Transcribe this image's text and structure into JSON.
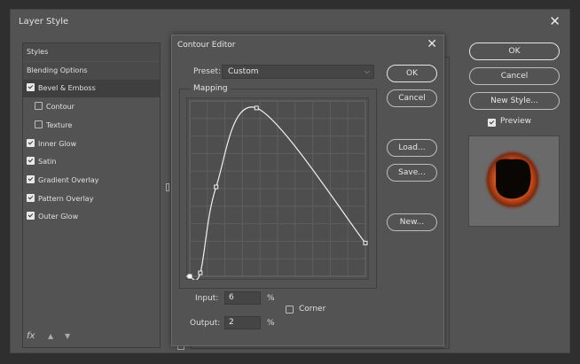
{
  "window": {
    "title": "Layer Style",
    "close_glyph": "✕"
  },
  "styles_list": [
    {
      "label": "Styles",
      "checkbox": false,
      "type": "header"
    },
    {
      "label": "Blending Options",
      "checkbox": false,
      "type": "header"
    },
    {
      "label": "Bevel & Emboss",
      "checkbox": true,
      "checked": true,
      "type": "selected"
    },
    {
      "label": "Contour",
      "checkbox": true,
      "checked": false,
      "type": "sub"
    },
    {
      "label": "Texture",
      "checkbox": true,
      "checked": false,
      "type": "sub"
    },
    {
      "label": "Inner Glow",
      "checkbox": true,
      "checked": true,
      "type": "item"
    },
    {
      "label": "Satin",
      "checkbox": true,
      "checked": true,
      "type": "item"
    },
    {
      "label": "Gradient Overlay",
      "checkbox": true,
      "checked": true,
      "type": "item"
    },
    {
      "label": "Pattern Overlay",
      "checkbox": true,
      "checked": true,
      "type": "item"
    },
    {
      "label": "Outer Glow",
      "checkbox": true,
      "checked": true,
      "type": "item"
    }
  ],
  "footer": {
    "fx_label": "fx",
    "up_glyph": "▲",
    "down_glyph": "▼"
  },
  "right_buttons": {
    "ok": "OK",
    "cancel": "Cancel",
    "new_style": "New Style..."
  },
  "preview": {
    "label": "Preview",
    "checked": true
  },
  "contour_editor": {
    "title": "Contour Editor",
    "close_glyph": "✕",
    "preset_label": "Preset:",
    "preset_value": "Custom",
    "mapping_label": "Mapping",
    "input_label": "Input:",
    "input_value": "6",
    "output_label": "Output:",
    "output_value": "2",
    "percent": "%",
    "corner_label": "Corner",
    "corner_checked": false,
    "buttons": {
      "ok": "OK",
      "cancel": "Cancel",
      "load": "Load...",
      "save": "Save...",
      "new": "New..."
    },
    "curve_points": [
      {
        "input": 0,
        "output": 0
      },
      {
        "input": 6,
        "output": 2
      },
      {
        "input": 15,
        "output": 51
      },
      {
        "input": 38,
        "output": 96
      },
      {
        "input": 100,
        "output": 19
      }
    ]
  },
  "colors": {
    "dialog_bg": "#535353",
    "glow": "#f05a1a"
  }
}
